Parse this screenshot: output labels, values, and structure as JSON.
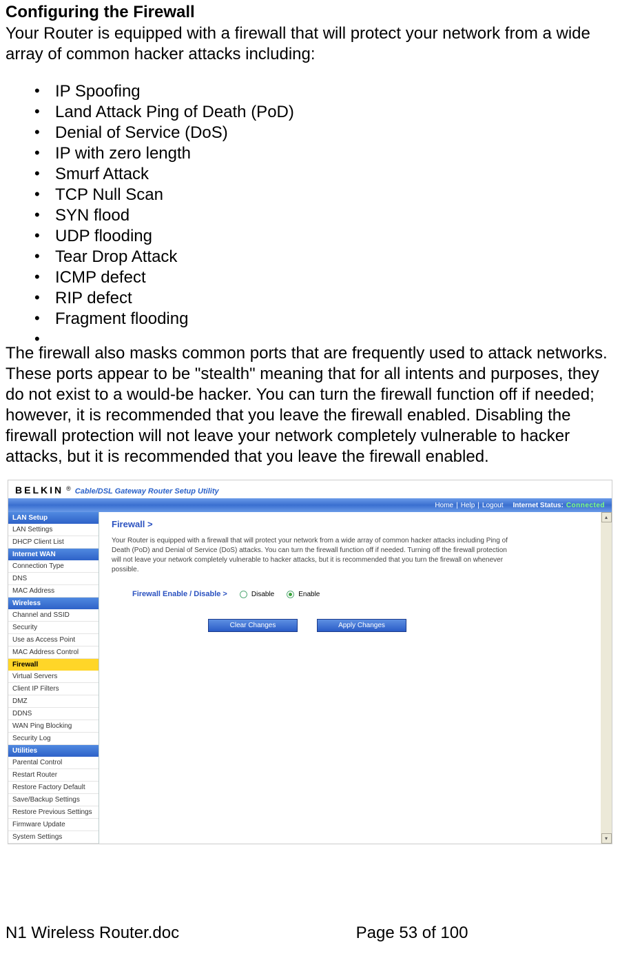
{
  "doc": {
    "title": "Configuring the Firewall",
    "intro": "Your Router is equipped with a firewall that will protect your network from a wide array of common hacker attacks including:",
    "bullets": [
      "IP Spoofing",
      "Land Attack Ping of Death (PoD)",
      "Denial of Service (DoS)",
      "IP with zero length",
      "Smurf Attack",
      "TCP Null Scan",
      "SYN flood",
      "UDP flooding",
      "Tear Drop Attack",
      "ICMP defect",
      "RIP defect",
      "Fragment flooding"
    ],
    "paragraph": "The firewall also masks common ports that are frequently used to attack networks. These ports appear to be \"stealth\" meaning that for all intents and purposes, they do not exist to a would-be hacker. You can turn the firewall function off if needed; however, it is recommended that you leave the firewall enabled. Disabling the firewall protection will not leave your network completely vulnerable to hacker attacks, but it is recommended that you leave the firewall enabled."
  },
  "router": {
    "brand": "BELKIN",
    "reg": "®",
    "subtitle": "Cable/DSL Gateway Router Setup Utility",
    "topnav": {
      "home": "Home",
      "help": "Help",
      "logout": "Logout",
      "status_label": "Internet Status:",
      "status_value": "Connected"
    },
    "sidebar": {
      "lan_setup": "LAN Setup",
      "lan_items": [
        "LAN Settings",
        "DHCP Client List"
      ],
      "internet_wan": "Internet WAN",
      "wan_items": [
        "Connection Type",
        "DNS",
        "MAC Address"
      ],
      "wireless": "Wireless",
      "wireless_items": [
        "Channel and SSID",
        "Security",
        "Use as Access Point",
        "MAC Address Control"
      ],
      "firewall": "Firewall",
      "firewall_items": [
        "Virtual Servers",
        "Client IP Filters",
        "DMZ",
        "DDNS",
        "WAN Ping Blocking",
        "Security Log"
      ],
      "utilities": "Utilities",
      "utilities_items": [
        "Parental Control",
        "Restart Router",
        "Restore Factory Default",
        "Save/Backup Settings",
        "Restore Previous Settings",
        "Firmware Update",
        "System Settings"
      ]
    },
    "main": {
      "heading": "Firewall >",
      "desc": "Your Router is equipped with a firewall that will protect your network from a wide array of common hacker attacks including Ping of Death (PoD) and Denial of Service (DoS) attacks. You can turn the firewall function off if needed. Turning off the firewall protection will not leave your network completely vulnerable to hacker attacks, but it is recommended that you turn the firewall on whenever possible.",
      "setting_label": "Firewall Enable / Disable >",
      "disable_label": "Disable",
      "enable_label": "Enable",
      "clear_btn": "Clear Changes",
      "apply_btn": "Apply Changes"
    }
  },
  "footer": {
    "left": "N1 Wireless Router.doc",
    "center": "Page 53 of 100"
  }
}
